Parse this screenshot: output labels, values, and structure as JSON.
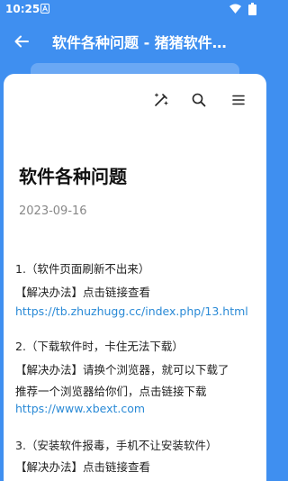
{
  "status_bar": {
    "time": "10:25"
  },
  "app_bar": {
    "title": "软件各种问题 - 猪猪软件…"
  },
  "icons": {
    "back": "arrow-back-icon",
    "magic": "magic-wand-icon",
    "search": "search-icon",
    "menu": "hamburger-menu-icon"
  },
  "article": {
    "title": "软件各种问题",
    "date": "2023-09-16",
    "items": [
      {
        "question": "1.（软件页面刷新不出来）",
        "solution": "【解决办法】点击链接查看",
        "link": "https://tb.zhuzhugg.cc/index.php/13.html"
      },
      {
        "question": "2.（下载软件时，卡住无法下载）",
        "solution": "【解决办法】请换个浏览器，就可以下载了",
        "extra": "推荐一个浏览器给你们，点击链接下载",
        "link": "https://www.xbext.com"
      },
      {
        "question": "3.（安装软件报毒，手机不让安装软件）",
        "solution": "【解决办法】点击链接查看"
      }
    ]
  },
  "colors": {
    "primary": "#3f8ff0",
    "link": "#2a8ad6",
    "date": "#888888"
  }
}
